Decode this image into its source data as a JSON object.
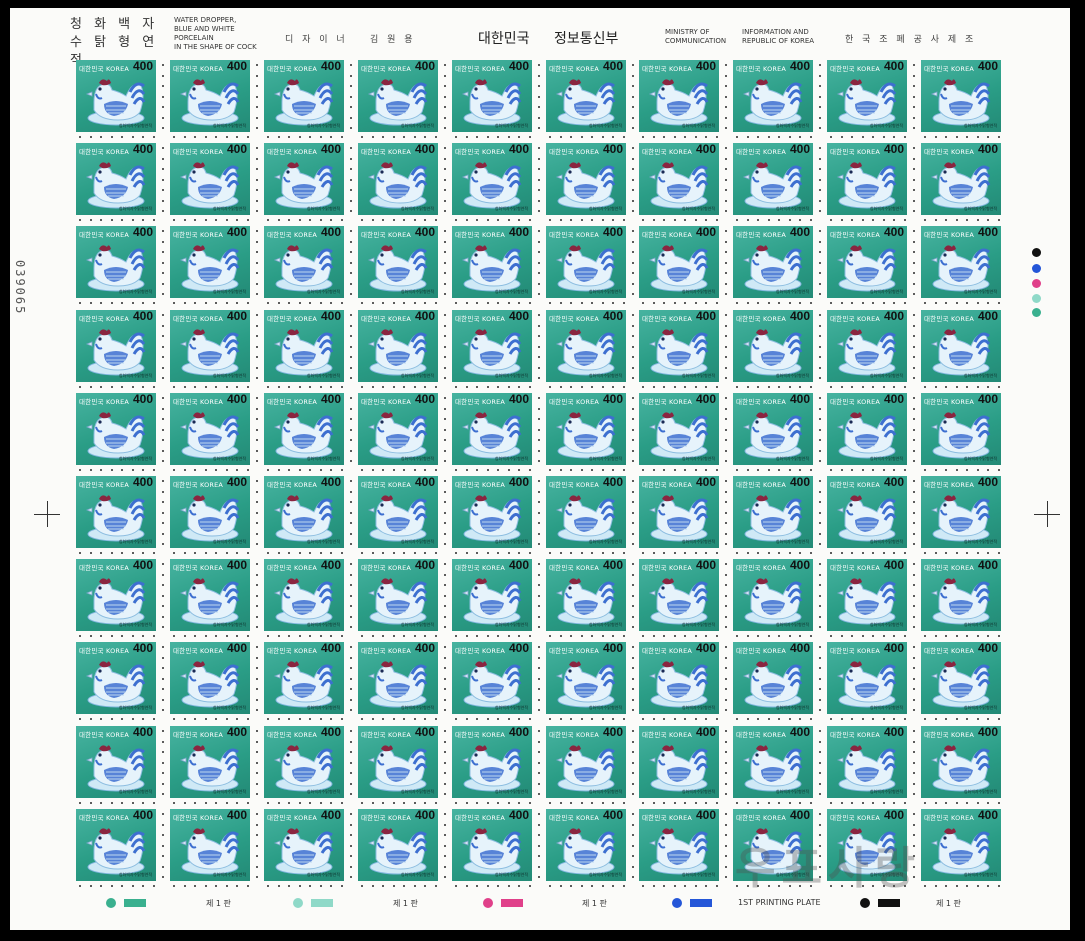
{
  "header": {
    "title_ko_line1": "청 화 백 자",
    "title_ko_line2": "수 탉 형 연 적",
    "title_en": [
      "WATER DROPPER,",
      "BLUE AND WHITE PORCELAIN",
      "IN THE SHAPE OF COCK"
    ],
    "designer_label": "디 자 이 너",
    "designer_name": "김 원 용",
    "country_ko": "대한민국",
    "ministry_ko": "정보통신부",
    "ministry_en": [
      "MINISTRY OF",
      "COMMUNICATION"
    ],
    "info_en": [
      "INFORMATION AND",
      "REPUBLIC OF KOREA"
    ],
    "printer_ko": "한 국 조 폐 공 사 제 조"
  },
  "stamp": {
    "title": "대한민국 KOREA",
    "value": "400",
    "caption": "청화백자수탉형연적",
    "rows": 10,
    "cols": 10
  },
  "serial_number": "039065",
  "footer": {
    "plate_label": "제 1 판",
    "printing_plate_en": "1ST PRINTING PLATE"
  },
  "watermark": "우표사랑",
  "colors": {
    "stamp_green": "#2fa38b",
    "cock_blue": "#3d6fd0",
    "comb_red": "#8a2540",
    "plate_green": "#3ab08f",
    "plate_cyan": "#8fd9c8",
    "plate_magenta": "#e0408a",
    "plate_blue": "#2456d8",
    "plate_black": "#111111"
  }
}
